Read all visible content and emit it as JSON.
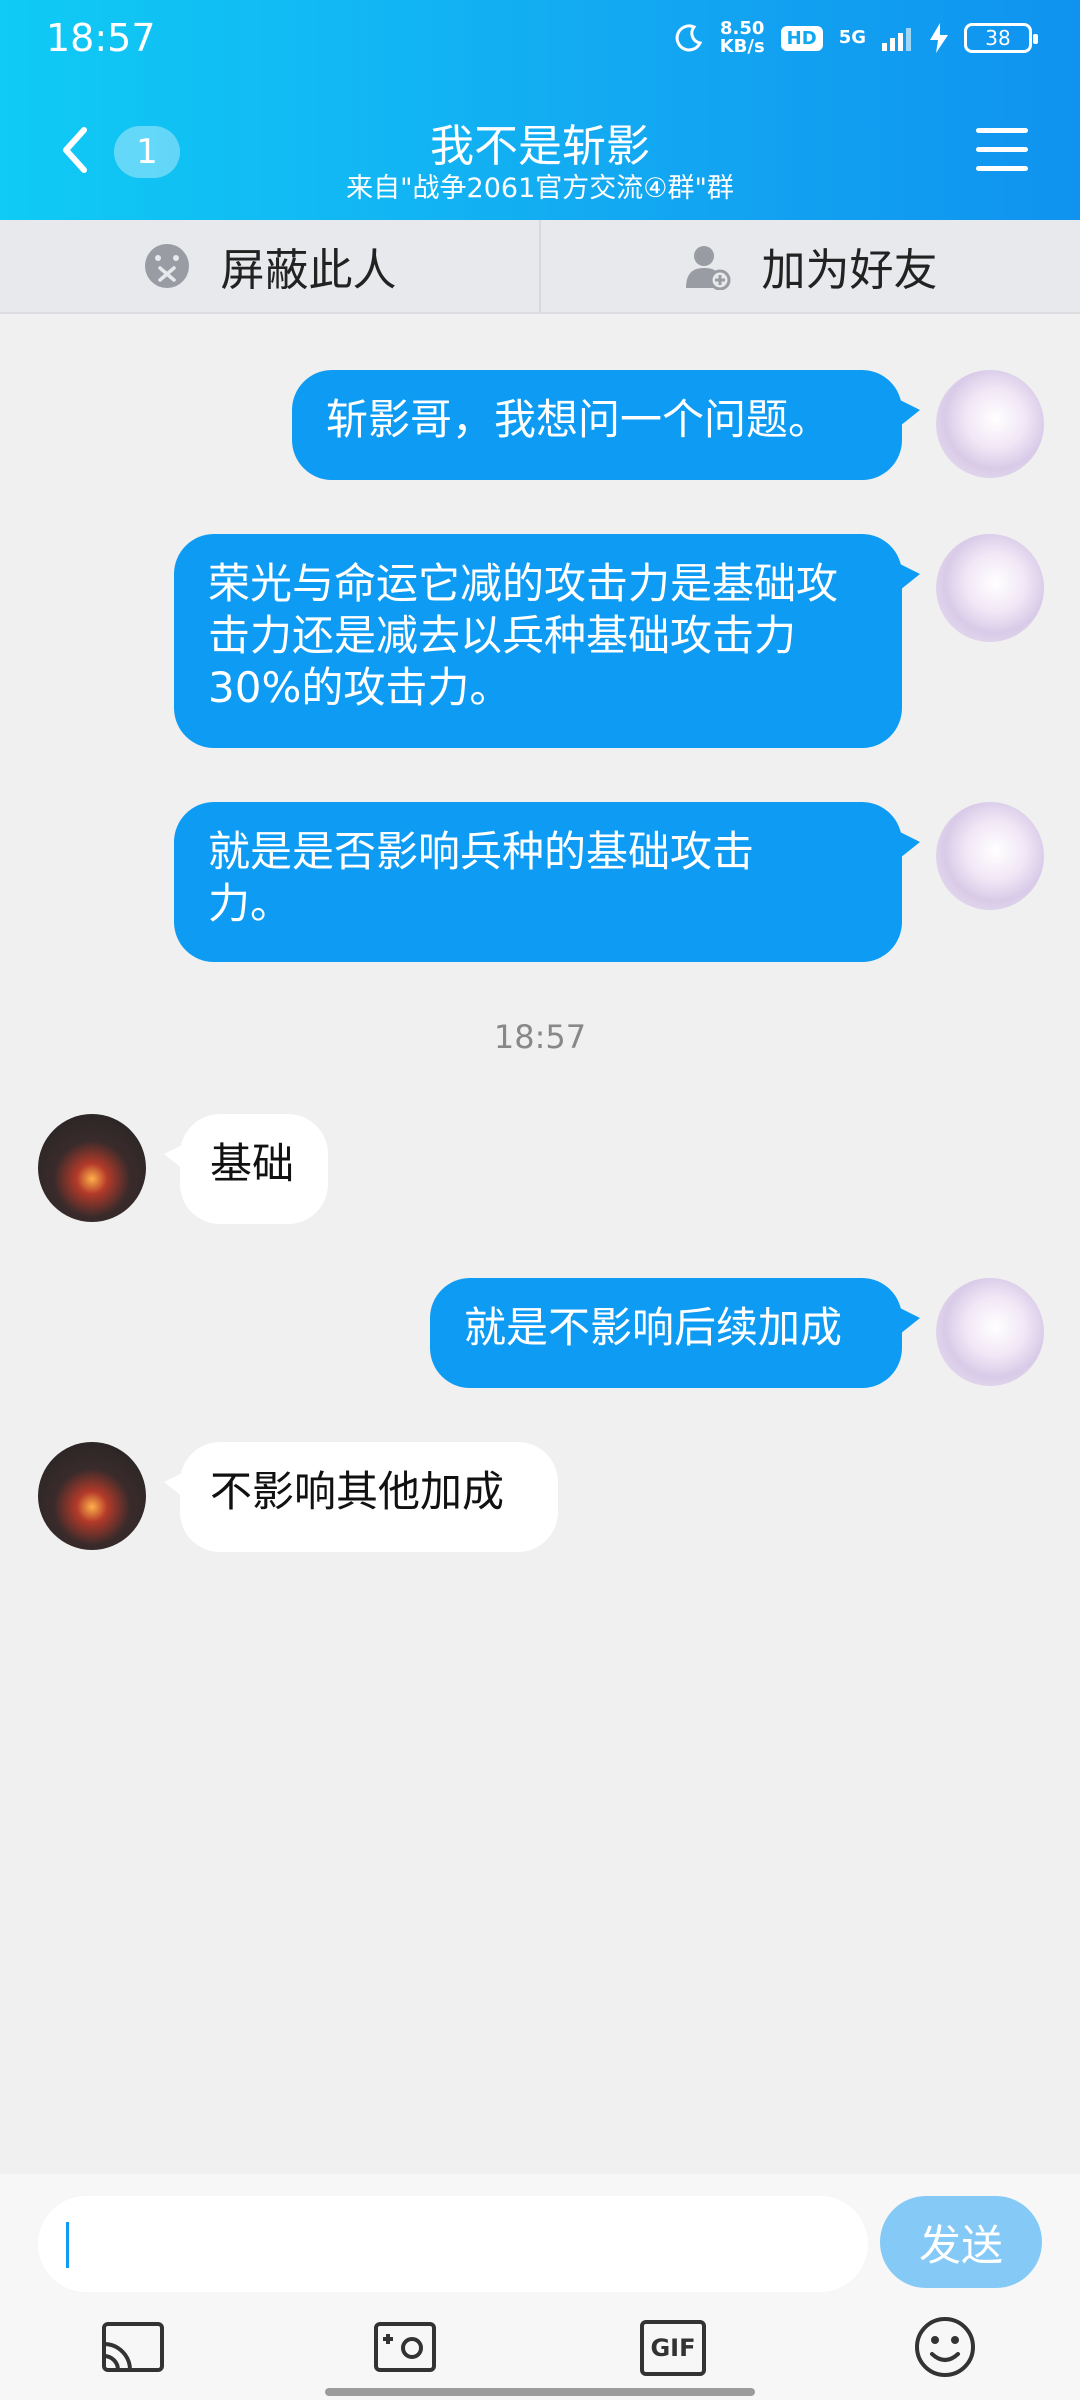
{
  "status": {
    "time": "18:57",
    "speed_value": "8.50",
    "speed_unit": "KB/s",
    "hd": "HD",
    "network": "5G",
    "battery": "38"
  },
  "header": {
    "unread": "1",
    "title": "我不是斩影",
    "subtitle": "来自\"战争2061官方交流④群\"群"
  },
  "actions": {
    "block": "屏蔽此人",
    "add_friend": "加为好友"
  },
  "messages": [
    {
      "side": "out",
      "text": "斩影哥，我想问一个问题。"
    },
    {
      "side": "out",
      "text": "荣光与命运它减的攻击力是基础攻击力还是减去以兵种基础攻击力30%的攻击力。"
    },
    {
      "side": "out",
      "text": "就是是否影响兵种的基础攻击力。"
    },
    {
      "side": "in",
      "text": "基础"
    },
    {
      "side": "out",
      "text": "就是不影响后续加成"
    },
    {
      "side": "in",
      "text": "不影响其他加成"
    }
  ],
  "timestamp": "18:57",
  "input": {
    "send_label": "发送"
  },
  "toolbar": {
    "gif": "GIF"
  }
}
